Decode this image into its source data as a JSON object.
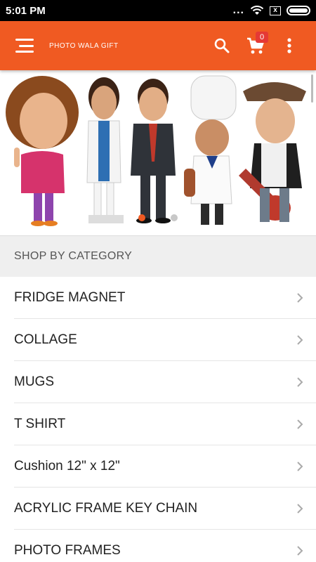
{
  "status_bar": {
    "time": "5:01 PM",
    "dots": "...",
    "x_icon": "x"
  },
  "app_bar": {
    "title": "PHOTO WALA GIFT",
    "cart_count": "0",
    "menu_icon": "hamburger-menu-icon",
    "search_icon": "search-icon",
    "cart_icon": "cart-icon",
    "overflow_icon": "more-vert-icon"
  },
  "banner": {
    "slide_count": 2,
    "active_slide": 1
  },
  "section": {
    "title": "SHOP BY CATEGORY"
  },
  "categories": [
    {
      "label": "FRIDGE MAGNET"
    },
    {
      "label": "COLLAGE"
    },
    {
      "label": "MUGS"
    },
    {
      "label": "T SHIRT"
    },
    {
      "label": "Cushion 12\" x 12\""
    },
    {
      "label": "ACRYLIC FRAME KEY CHAIN"
    },
    {
      "label": "PHOTO FRAMES"
    }
  ],
  "colors": {
    "primary": "#f05a22",
    "badge": "#e53935",
    "section_bg": "#efefef"
  }
}
